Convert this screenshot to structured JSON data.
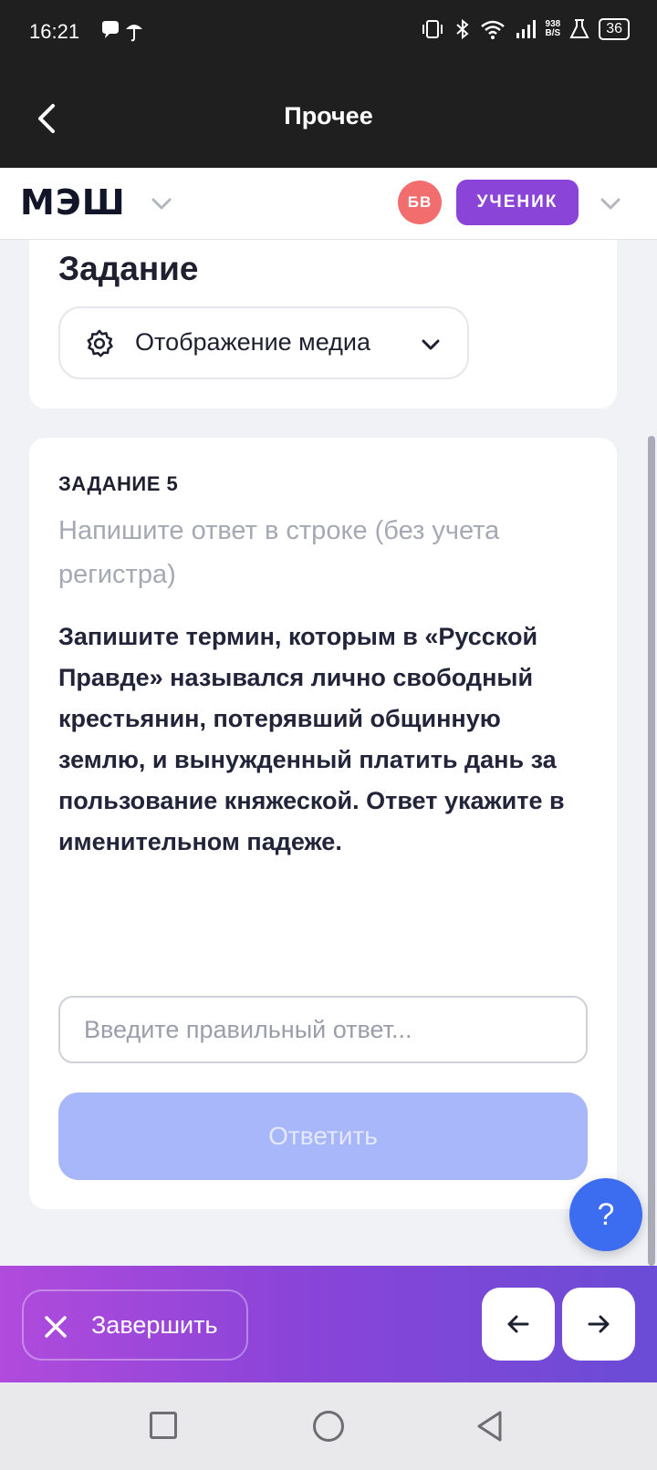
{
  "status_bar": {
    "time": "16:21",
    "net_speed_value": "938",
    "net_speed_unit": "B/S",
    "battery": "36"
  },
  "title_bar": {
    "title": "Прочее"
  },
  "app_header": {
    "logo": "МЭШ",
    "avatar_initials": "БВ",
    "role": "УЧЕНИК"
  },
  "section": {
    "title": "Задание",
    "media_dropdown": "Отображение медиа"
  },
  "task": {
    "label": "ЗАДАНИЕ 5",
    "hint": "Напишите ответ в строке (без учета регистра)",
    "question": "Запишите термин, которым в «Русской Правде» назывался лично свободный крестьянин, потерявший общинную землю, и вынужденный платить дань за пользование княжеской. Ответ укажите в именительном падеже.",
    "answer_placeholder": "Введите правильный ответ...",
    "answer_value": "",
    "submit": "Ответить"
  },
  "help": {
    "label": "?"
  },
  "action_bar": {
    "finish": "Завершить"
  },
  "colors": {
    "accent": "#8a44d8",
    "avatar": "#f26d6d",
    "help": "#3c6cf0",
    "submit_disabled": "#a8b6fa"
  },
  "icons": [
    "back-arrow-icon",
    "chevron-down-icon",
    "gear-icon",
    "close-icon",
    "arrow-left-icon",
    "arrow-right-icon"
  ]
}
